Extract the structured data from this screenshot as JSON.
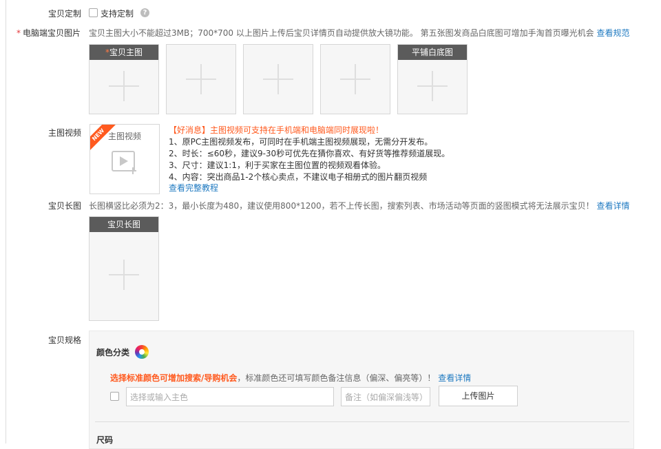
{
  "customize": {
    "label": "宝贝定制",
    "checkbox_label": "支持定制",
    "help_icon": "?"
  },
  "pc_images": {
    "label": "电脑端宝贝图片",
    "required_mark": "*",
    "hint": "宝贝主图大小不能超过3MB；700*700 以上图片上传后宝贝详情页自动提供放大镜功能。 第五张图发商品白底图可增加手淘首页曝光机会",
    "link": "查看规范",
    "tiles": [
      {
        "title": "宝贝主图",
        "star": "*"
      },
      {
        "title": ""
      },
      {
        "title": ""
      },
      {
        "title": ""
      },
      {
        "title": "平铺白底图"
      }
    ]
  },
  "video": {
    "label": "主图视频",
    "box_title": "主图视频",
    "badge": "NEW",
    "news_head": "【好消息】主图视频可支持在手机端和电脑端同时展现啦！",
    "items": [
      "1、原PC主图视频发布，可同时在手机端主图视频展现，无需分开发布。",
      "2、时长：≤60秒，建议9-30秒可优先在猜你喜欢、有好货等推荐频道展现。",
      "3、尺寸：建议1:1，利于买家在主图位置的视频观看体验。",
      "4、内容：突出商品1-2个核心卖点，不建议电子相册式的图片翻页视频"
    ],
    "tutorial_link": "查看完整教程"
  },
  "long_image": {
    "label": "宝贝长图",
    "hint": "长图横竖比必须为2：3，最小长度为480，建议使用800*1200，若不上传长图，搜索列表、市场活动等页面的竖图模式将无法展示宝贝！",
    "link": "查看详情",
    "tile_title": "宝贝长图"
  },
  "spec": {
    "label": "宝贝规格",
    "color_title": "颜色分类",
    "color_promo": "选择标准颜色可增加搜索/导购机会",
    "color_hint": "，标准颜色还可填写颜色备注信息（偏深、偏亮等）！",
    "color_link": "查看详情",
    "color_input_placeholder": "选择或输入主色",
    "note_input_placeholder": "备注（如偏深偏浅等）",
    "upload_button": "上传图片",
    "size_title": "尺码"
  },
  "colors": {
    "accent_orange": "#ff5a1f",
    "link_blue": "#1f7ac1",
    "tile_header": "#5b5b5b"
  }
}
